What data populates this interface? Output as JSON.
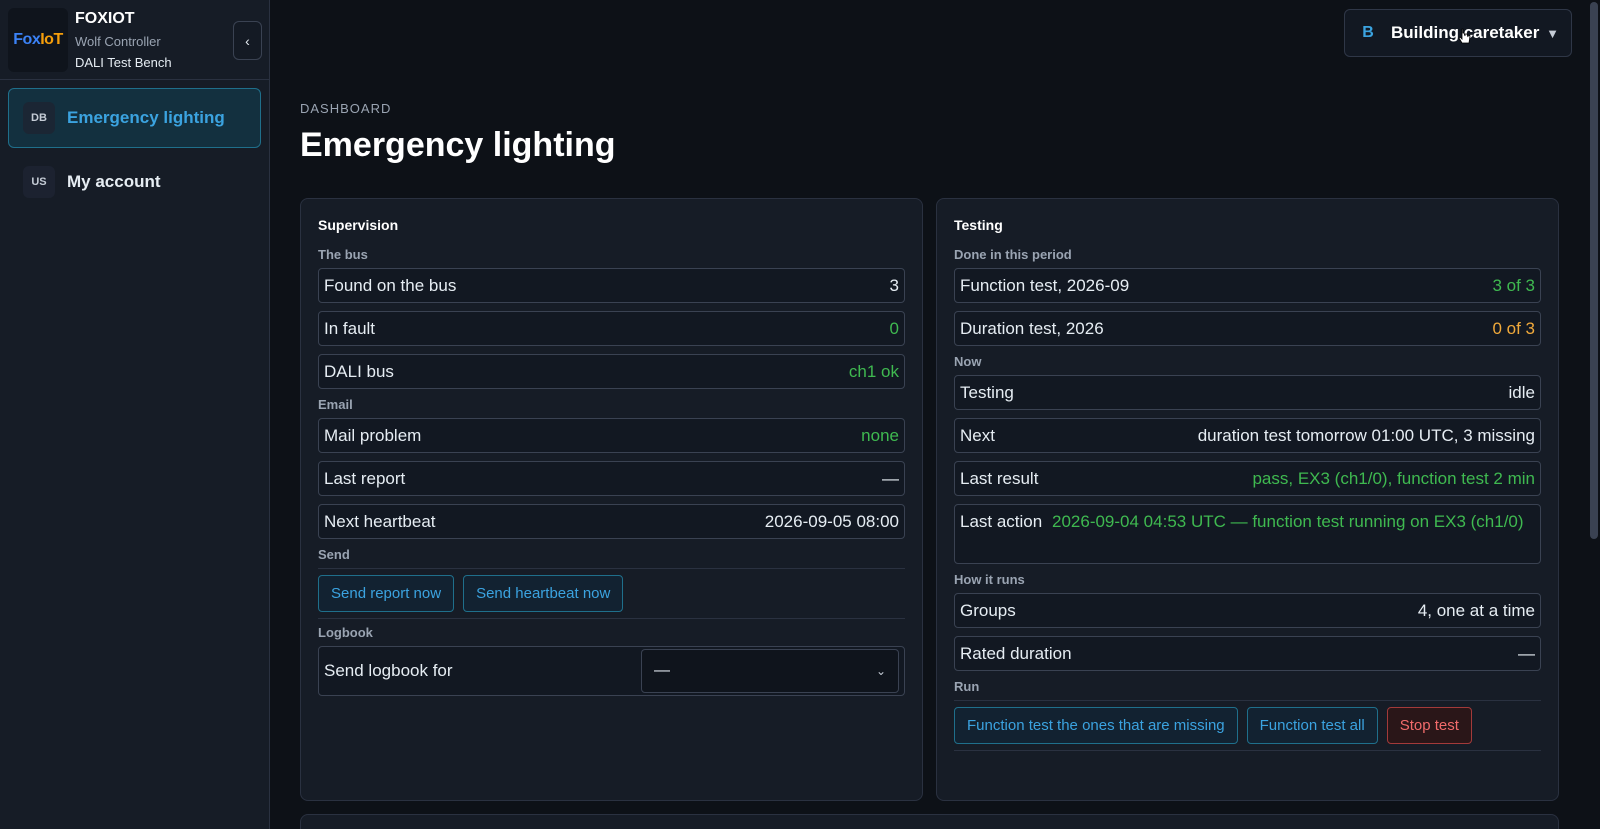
{
  "sidebar": {
    "logo": {
      "part1": "Fox",
      "part2": "IoT"
    },
    "brand_name": "FOXIOT",
    "brand_sub": "Wolf Controller",
    "brand_bench": "DALI Test Bench",
    "collapse_label": "‹",
    "items": [
      {
        "badge": "DB",
        "label": "Emergency lighting",
        "active": true
      },
      {
        "badge": "US",
        "label": "My account",
        "active": false
      }
    ]
  },
  "user_menu": {
    "initial": "B",
    "name": "Building caretaker",
    "caret": "▼"
  },
  "header": {
    "breadcrumb": "DASHBOARD",
    "title": "Emergency lighting"
  },
  "supervision": {
    "title": "Supervision",
    "bus_section": "The bus",
    "found_label": "Found on the bus",
    "found_value": "3",
    "fault_label": "In fault",
    "fault_value": "0",
    "dali_label": "DALI bus",
    "dali_value": "ch1 ok",
    "email_section": "Email",
    "mail_label": "Mail problem",
    "mail_value": "none",
    "report_label": "Last report",
    "report_value": "—",
    "heartbeat_label": "Next heartbeat",
    "heartbeat_value": "2026-09-05 08:00",
    "send_section": "Send",
    "send_report_label": "Send report now",
    "send_heartbeat_label": "Send heartbeat now",
    "logbook_section": "Logbook",
    "logbook_label": "Send logbook for",
    "logbook_selected": "—"
  },
  "testing": {
    "title": "Testing",
    "done_section": "Done in this period",
    "function_label": "Function test, 2026-09",
    "function_value": "3 of 3",
    "duration_label": "Duration test, 2026",
    "duration_value": "0 of 3",
    "now_section": "Now",
    "testing_label": "Testing",
    "testing_value": "idle",
    "next_label": "Next",
    "next_value": "duration test tomorrow 01:00 UTC, 3 missing",
    "result_label": "Last result",
    "result_value": "pass, EX3 (ch1/0), function test 2 min",
    "action_label": "Last action",
    "action_value": "2026-09-04 04:53 UTC — function test running on EX3 (ch1/0)",
    "how_section": "How it runs",
    "groups_label": "Groups",
    "groups_value": "4, one at a time",
    "rated_label": "Rated duration",
    "rated_value": "—",
    "run_section": "Run",
    "btn_missing_label": "Function test the ones that are missing",
    "btn_all_label": "Function test all",
    "btn_stop_label": "Stop test"
  },
  "colors": {
    "accent": "#3ba3e0",
    "ok": "#3fb950",
    "warn": "#f0a93b",
    "danger": "#f26b6b"
  }
}
